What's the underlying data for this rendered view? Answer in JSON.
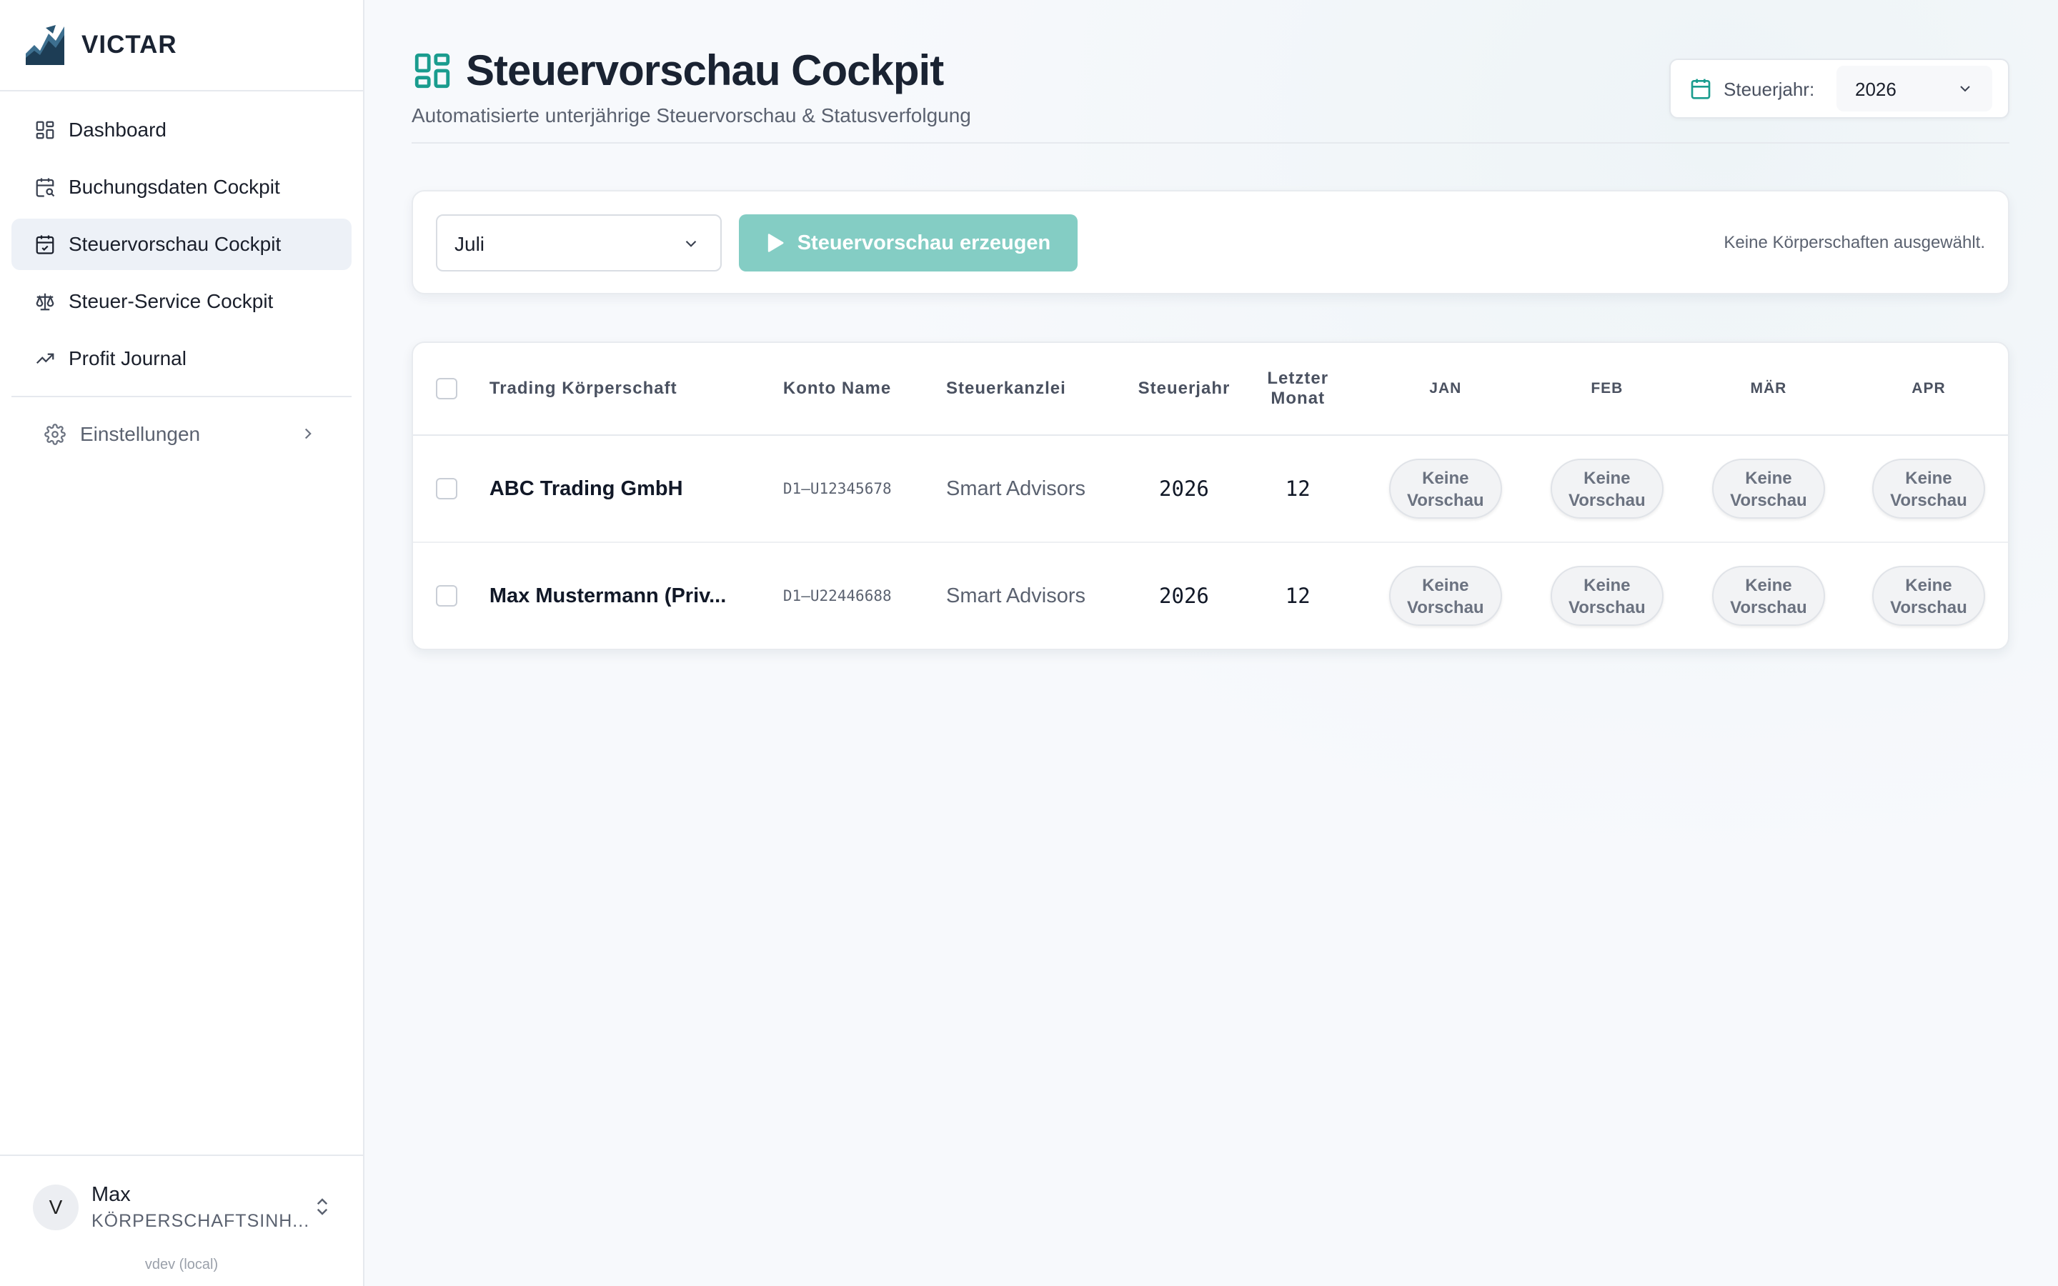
{
  "brand": {
    "name": "VICTAR"
  },
  "sidebar": {
    "items": [
      {
        "label": "Dashboard",
        "icon": "dashboard-icon"
      },
      {
        "label": "Buchungsdaten Cockpit",
        "icon": "calendar-search-icon"
      },
      {
        "label": "Steuervorschau Cockpit",
        "icon": "calendar-check-icon",
        "active": true
      },
      {
        "label": "Steuer-Service Cockpit",
        "icon": "scale-icon"
      },
      {
        "label": "Profit Journal",
        "icon": "trending-up-icon"
      }
    ],
    "settings": {
      "label": "Einstellungen",
      "icon": "gear-icon"
    },
    "user": {
      "initial": "V",
      "name": "Max",
      "role": "KÖRPERSCHAFTSINH..."
    },
    "version": "vdev (local)"
  },
  "header": {
    "title": "Steuervorschau Cockpit",
    "subtitle": "Automatisierte unterjährige Steuervorschau & Statusverfolgung",
    "year_label": "Steuerjahr:",
    "year_value": "2026"
  },
  "toolbar": {
    "month_value": "Juli",
    "generate_label": "Steuervorschau erzeugen",
    "status": "Keine Körperschaften ausgewählt."
  },
  "table": {
    "headers": {
      "entity": "Trading Körperschaft",
      "account": "Konto Name",
      "firm": "Steuerkanzlei",
      "year": "Steuerjahr",
      "last_month_1": "Letzter",
      "last_month_2": "Monat",
      "m1": "JAN",
      "m2": "FEB",
      "m3": "MÄR",
      "m4": "APR"
    },
    "rows": [
      {
        "entity": "ABC Trading GmbH",
        "account": "D1–U12345678",
        "firm": "Smart Advisors",
        "year": "2026",
        "last_month": "12",
        "m1a": "Keine",
        "m1b": "Vorschau",
        "m2a": "Keine",
        "m2b": "Vorschau",
        "m3a": "Keine",
        "m3b": "Vorschau",
        "m4a": "Keine",
        "m4b": "Vorschau"
      },
      {
        "entity": "Max Mustermann (Priv...",
        "account": "D1–U22446688",
        "firm": "Smart Advisors",
        "year": "2026",
        "last_month": "12",
        "m1a": "Keine",
        "m1b": "Vorschau",
        "m2a": "Keine",
        "m2b": "Vorschau",
        "m3a": "Keine",
        "m3b": "Vorschau",
        "m4a": "Keine",
        "m4b": "Vorschau"
      }
    ]
  },
  "colors": {
    "accent": "#1a9c8e",
    "button": "#84cdc4",
    "active_nav": "#edf1f7"
  }
}
